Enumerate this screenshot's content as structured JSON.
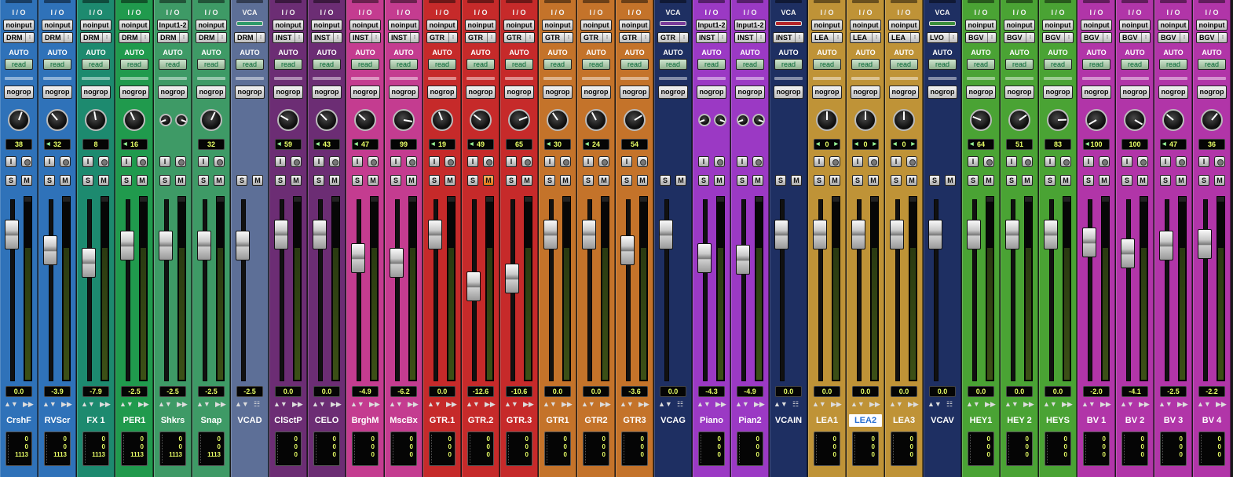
{
  "labels": {
    "io": "I / O",
    "vca": "VCA",
    "auto": "AUTO",
    "auto_mode": "read",
    "group": "nogrop",
    "input_btn": "I",
    "solo": "S",
    "mute": "M"
  },
  "icons": {
    "output_arrow": "up-down-arrow-icon",
    "automation": "automation-arrow-icon",
    "vca_assign": "vca-assign-icon",
    "knob": "pan-knob-icon"
  },
  "strips": [
    {
      "name": "CrshF",
      "type": "audio",
      "color": "#2f72b9",
      "input": "noinput",
      "output": "DRM",
      "pan": "38",
      "pan_dir": "",
      "volume": "0.0",
      "counter": [
        "0",
        "0",
        "1113"
      ],
      "fader": 0.45,
      "knob": 20,
      "mute_on": false
    },
    {
      "name": "RVScr",
      "type": "audio",
      "color": "#2f72b9",
      "input": "noinput",
      "output": "DRM",
      "pan": "32",
      "pan_dir": "left",
      "volume": "-3.9",
      "counter": [
        "0",
        "0",
        "1113"
      ],
      "fader": 0.55,
      "knob": -40
    },
    {
      "name": "FX 1",
      "type": "audio",
      "color": "#1d8a6f",
      "input": "noinput",
      "output": "DRM",
      "pan": "8",
      "pan_dir": "",
      "volume": "-7.9",
      "counter": [
        "0",
        "0",
        "1113"
      ],
      "fader": 0.63,
      "knob": -10
    },
    {
      "name": "PER1",
      "type": "audio",
      "color": "#209a4d",
      "input": "noinput",
      "output": "DRM",
      "pan": "16",
      "pan_dir": "left",
      "volume": "-2.5",
      "counter": [
        "0",
        "0",
        "1113"
      ],
      "fader": 0.52,
      "knob": -25
    },
    {
      "name": "Shkrs",
      "type": "audio",
      "color": "#3e9a66",
      "input": "Input1-2",
      "output": "DRM",
      "pan": "",
      "pan_dir": "",
      "volume": "-2.5",
      "counter": [
        "0",
        "0",
        "1113"
      ],
      "fader": 0.52,
      "knob": 0,
      "stereo": true
    },
    {
      "name": "Snap",
      "type": "audio",
      "color": "#3e9a66",
      "input": "noinput",
      "output": "DRM",
      "pan": "32",
      "pan_dir": "",
      "volume": "-2.5",
      "counter": [
        "0",
        "0",
        "1113"
      ],
      "fader": 0.52,
      "knob": 25
    },
    {
      "name": "VCAD",
      "type": "vca",
      "color": "#5d6f97",
      "input": "",
      "output": "DRM",
      "pan": "",
      "pan_dir": "",
      "volume": "-2.5",
      "counter": [],
      "fader": 0.52,
      "knob": 0,
      "vca_color": "#2f9a6a"
    },
    {
      "name": "ClSctP",
      "type": "audio",
      "color": "#6c2d74",
      "input": "noinput",
      "output": "INST",
      "pan": "59",
      "pan_dir": "left",
      "volume": "0.0",
      "counter": [
        "0",
        "0",
        "0"
      ],
      "fader": 0.45,
      "knob": -60
    },
    {
      "name": "CELO",
      "type": "audio",
      "color": "#6c2d74",
      "input": "noinput",
      "output": "INST",
      "pan": "43",
      "pan_dir": "left",
      "volume": "0.0",
      "counter": [
        "0",
        "0",
        "0"
      ],
      "fader": 0.45,
      "knob": -45
    },
    {
      "name": "BrghM",
      "type": "audio",
      "color": "#c43c90",
      "input": "noinput",
      "output": "INST",
      "pan": "47",
      "pan_dir": "left",
      "volume": "-4.9",
      "counter": [
        "0",
        "0",
        "0"
      ],
      "fader": 0.6,
      "knob": -48
    },
    {
      "name": "MscBx",
      "type": "audio",
      "color": "#c43c90",
      "input": "noinput",
      "output": "INST",
      "pan": "99",
      "pan_dir": "",
      "volume": "-6.2",
      "counter": [
        "0",
        "0",
        "0"
      ],
      "fader": 0.63,
      "knob": 100
    },
    {
      "name": "GTR.1",
      "type": "audio",
      "color": "#c62a2a",
      "input": "noinput",
      "output": "GTR",
      "pan": "19",
      "pan_dir": "left",
      "volume": "0.0",
      "counter": [
        "0",
        "0",
        "0"
      ],
      "fader": 0.45,
      "knob": -22
    },
    {
      "name": "GTR.2",
      "type": "audio",
      "color": "#c62a2a",
      "input": "noinput",
      "output": "GTR",
      "pan": "49",
      "pan_dir": "left",
      "volume": "-12.6",
      "counter": [
        "0",
        "0",
        "0"
      ],
      "fader": 0.78,
      "knob": -52,
      "mute_on": true
    },
    {
      "name": "GTR.3",
      "type": "audio",
      "color": "#c62a2a",
      "input": "noinput",
      "output": "GTR",
      "pan": "65",
      "pan_dir": "",
      "volume": "-10.6",
      "counter": [
        "0",
        "0",
        "0"
      ],
      "fader": 0.73,
      "knob": 70
    },
    {
      "name": "GTR1",
      "type": "audio",
      "color": "#c4732a",
      "input": "noinput",
      "output": "GTR",
      "pan": "30",
      "pan_dir": "left",
      "volume": "0.0",
      "counter": [
        "0",
        "0",
        "0"
      ],
      "fader": 0.45,
      "knob": -34
    },
    {
      "name": "GTR2",
      "type": "audio",
      "color": "#c4732a",
      "input": "noinput",
      "output": "GTR",
      "pan": "24",
      "pan_dir": "left",
      "volume": "0.0",
      "counter": [
        "0",
        "0",
        "0"
      ],
      "fader": 0.45,
      "knob": -28
    },
    {
      "name": "GTR3",
      "type": "audio",
      "color": "#c4732a",
      "input": "noinput",
      "output": "GTR",
      "pan": "54",
      "pan_dir": "",
      "volume": "-3.6",
      "counter": [
        "0",
        "0",
        "0"
      ],
      "fader": 0.55,
      "knob": 58
    },
    {
      "name": "VCAG",
      "type": "vca",
      "color": "#1e2f62",
      "input": "",
      "output": "GTR",
      "pan": "",
      "pan_dir": "",
      "volume": "0.0",
      "counter": [],
      "fader": 0.45,
      "knob": 0,
      "vca_color": "#7a3d9a"
    },
    {
      "name": "Piano",
      "type": "audio",
      "color": "#9b39c4",
      "input": "Input1-2",
      "output": "INST",
      "pan": "",
      "pan_dir": "",
      "volume": "-4.3",
      "counter": [
        "0",
        "0",
        "0"
      ],
      "fader": 0.6,
      "knob": 0,
      "stereo": true
    },
    {
      "name": "Pian2",
      "type": "audio",
      "color": "#9b39c4",
      "input": "Input1-2",
      "output": "INST",
      "pan": "",
      "pan_dir": "",
      "volume": "-4.9",
      "counter": [
        "0",
        "0",
        "0"
      ],
      "fader": 0.61,
      "knob": 0,
      "stereo": true
    },
    {
      "name": "VCAIN",
      "type": "vca",
      "color": "#1e2f62",
      "input": "",
      "output": "INST",
      "pan": "",
      "pan_dir": "",
      "volume": "0.0",
      "counter": [],
      "fader": 0.45,
      "knob": 0,
      "vca_color": "#b5262a"
    },
    {
      "name": "LEA1",
      "type": "audio",
      "color": "#bf9337",
      "input": "noinput",
      "output": "LEA",
      "pan": "0",
      "pan_dir": "both",
      "volume": "0.0",
      "counter": [
        "0",
        "0",
        "0"
      ],
      "fader": 0.45,
      "knob": 0
    },
    {
      "name": "LEA2",
      "type": "audio",
      "color": "#bf9337",
      "input": "noinput",
      "output": "LEA",
      "pan": "0",
      "pan_dir": "both",
      "volume": "0.0",
      "counter": [
        "0",
        "0",
        "0"
      ],
      "fader": 0.45,
      "knob": 0,
      "selected": true
    },
    {
      "name": "LEA3",
      "type": "audio",
      "color": "#bf9337",
      "input": "noinput",
      "output": "LEA",
      "pan": "0",
      "pan_dir": "both",
      "volume": "0.0",
      "counter": [
        "0",
        "0",
        "0"
      ],
      "fader": 0.45,
      "knob": 0
    },
    {
      "name": "VCAV",
      "type": "vca",
      "color": "#1e2f62",
      "input": "",
      "output": "LVO",
      "pan": "",
      "pan_dir": "",
      "volume": "0.0",
      "counter": [],
      "fader": 0.45,
      "knob": 0,
      "vca_color": "#3c8f3c"
    },
    {
      "name": "HEY1",
      "type": "audio",
      "color": "#4aa334",
      "input": "noinput",
      "output": "BGV",
      "pan": "64",
      "pan_dir": "left",
      "volume": "0.0",
      "counter": [
        "0",
        "0",
        "0"
      ],
      "fader": 0.45,
      "knob": -68
    },
    {
      "name": "HEY 2",
      "type": "audio",
      "color": "#4aa334",
      "input": "noinput",
      "output": "BGV",
      "pan": "51",
      "pan_dir": "",
      "volume": "0.0",
      "counter": [
        "0",
        "0",
        "0"
      ],
      "fader": 0.45,
      "knob": 55
    },
    {
      "name": "HEYS",
      "type": "audio",
      "color": "#4aa334",
      "input": "noinput",
      "output": "BGV",
      "pan": "83",
      "pan_dir": "",
      "volume": "0.0",
      "counter": [
        "0",
        "0",
        "0"
      ],
      "fader": 0.45,
      "knob": 88
    },
    {
      "name": "BV 1",
      "type": "audio",
      "color": "#b135a8",
      "input": "noinput",
      "output": "BGV",
      "pan": "100",
      "pan_dir": "left",
      "volume": "-2.0",
      "counter": [
        "0",
        "0",
        "0"
      ],
      "fader": 0.5,
      "knob": -120
    },
    {
      "name": "BV 2",
      "type": "audio",
      "color": "#b135a8",
      "input": "noinput",
      "output": "BGV",
      "pan": "100",
      "pan_dir": "",
      "volume": "-4.1",
      "counter": [
        "0",
        "0",
        "0"
      ],
      "fader": 0.57,
      "knob": 120
    },
    {
      "name": "BV 3",
      "type": "audio",
      "color": "#b135a8",
      "input": "noinput",
      "output": "BGV",
      "pan": "47",
      "pan_dir": "left",
      "volume": "-2.5",
      "counter": [
        "0",
        "0",
        "0"
      ],
      "fader": 0.52,
      "knob": -50
    },
    {
      "name": "BV 4",
      "type": "audio",
      "color": "#b135a8",
      "input": "noinput",
      "output": "BGV",
      "pan": "36",
      "pan_dir": "",
      "volume": "-2.2",
      "counter": [
        "0",
        "0",
        "0"
      ],
      "fader": 0.51,
      "knob": 40
    }
  ]
}
